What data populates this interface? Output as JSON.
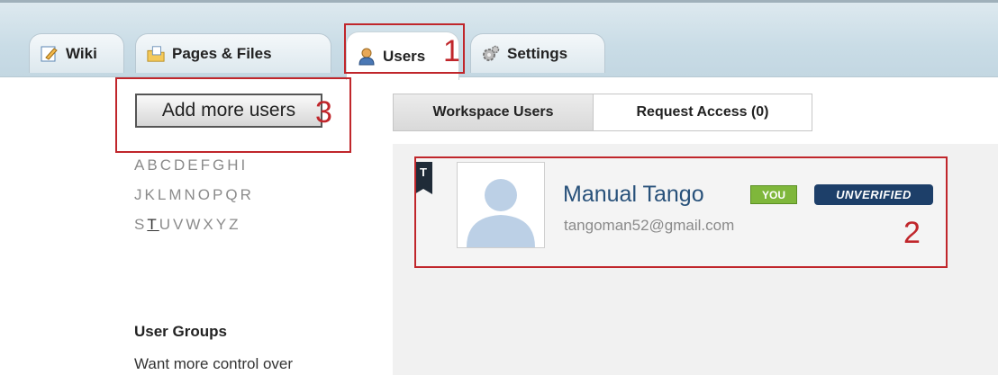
{
  "tabs": [
    {
      "label": "Wiki",
      "icon": "pencil-page-icon"
    },
    {
      "label": "Pages & Files",
      "icon": "folder-page-icon"
    },
    {
      "label": "Users",
      "icon": "user-icon"
    },
    {
      "label": "Settings",
      "icon": "gear-icon"
    }
  ],
  "annotations": {
    "one": "1",
    "two": "2",
    "three": "3"
  },
  "left": {
    "add_users_label": "Add more users",
    "alphabet": [
      [
        "A",
        "B",
        "C",
        "D",
        "E",
        "F",
        "G",
        "H",
        "I"
      ],
      [
        "J",
        "K",
        "L",
        "M",
        "N",
        "O",
        "P",
        "Q",
        "R"
      ],
      [
        "S",
        "T",
        "U",
        "V",
        "W",
        "X",
        "Y",
        "Z"
      ]
    ],
    "selected_letter": "T",
    "groups_title": "User Groups",
    "groups_text": "Want more control over"
  },
  "panel": {
    "subtabs": [
      "Workspace Users",
      "Request Access (0)"
    ],
    "user": {
      "flag_letter": "T",
      "name": "Manual Tango",
      "you_badge": "YOU",
      "status_badge": "UNVERIFIED",
      "email": "tangoman52@gmail.com"
    }
  },
  "colors": {
    "accent_red": "#c0262b",
    "name_blue": "#28517a",
    "you_green": "#7fb73b",
    "unverified_navy": "#1d3f69"
  }
}
